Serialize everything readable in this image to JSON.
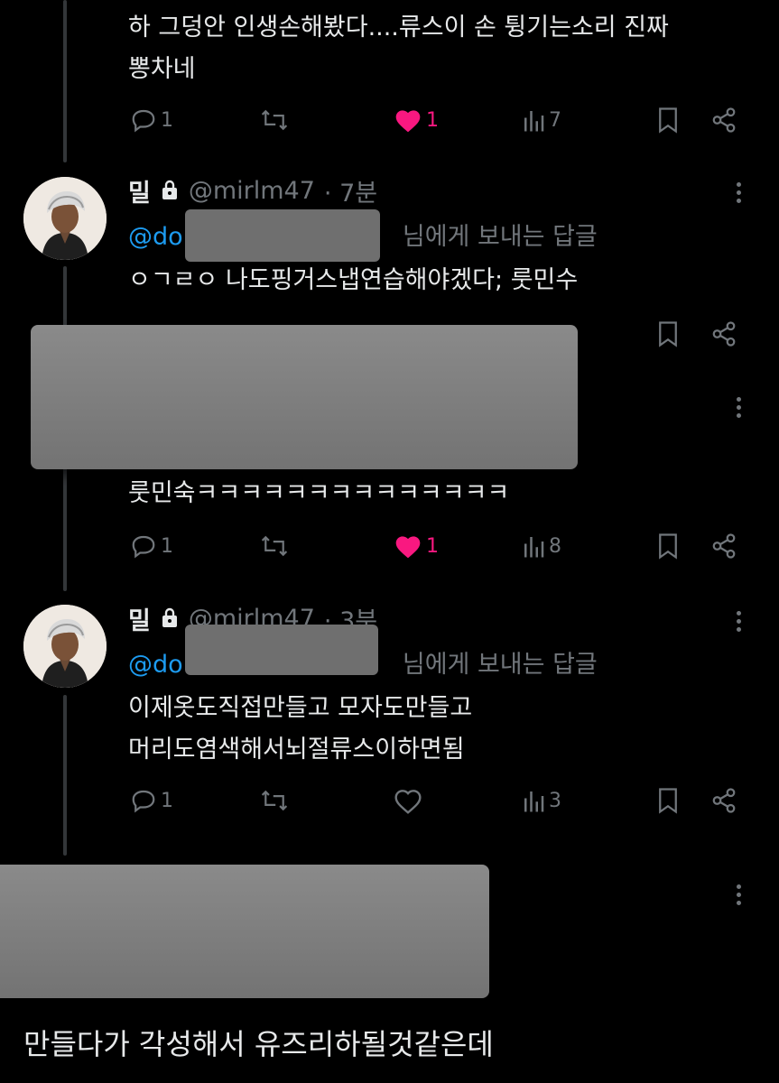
{
  "tweets": [
    {
      "text_lines": [
        "하 그덩안 인생손해봤다....류스이 손 튕기는소리 진짜",
        "뽕차네"
      ],
      "replies": "1",
      "likes": "1",
      "views": "7",
      "liked": true
    },
    {
      "name": "밀",
      "handle": "@mirlm47",
      "time": "· 7분",
      "mention": "@do",
      "reply_suffix": "님에게 보내는 답글",
      "text_lines": [
        "ㅇㄱㄹㅇ 나도핑거스냅연습해야겠다; 룻민수"
      ]
    },
    {
      "text_lines": [
        "룻민숙ㅋㅋㅋㅋㅋㅋㅋㅋㅋㅋㅋㅋㅋㅋ"
      ],
      "replies": "1",
      "likes": "1",
      "views": "8",
      "liked": true
    },
    {
      "name": "밀",
      "handle": "@mirlm47",
      "time": "· 3분",
      "mention": "@do",
      "reply_suffix": "님에게 보내는 답글",
      "text_lines": [
        "이제옷도직접만들고 모자도만들고",
        "머리도염색해서뇌절류스이하면됨"
      ],
      "replies": "1",
      "views": "3",
      "liked": false
    },
    {
      "text_lines": [
        "만들다가 각성해서 유즈리하될것같은데"
      ]
    }
  ],
  "colors": {
    "background": "#000000",
    "text": "#e7e9ea",
    "muted": "#71767b",
    "accent": "#1d9bf0",
    "like": "#f91880"
  },
  "icons": [
    "reply-icon",
    "retweet-icon",
    "heart-icon",
    "views-icon",
    "bookmark-icon",
    "share-icon",
    "lock-icon",
    "more-icon"
  ]
}
